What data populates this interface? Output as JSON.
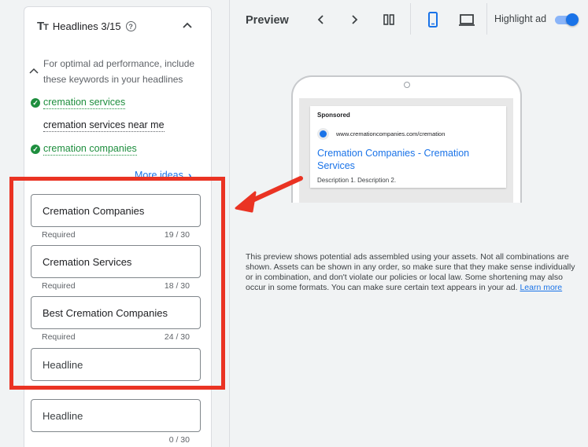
{
  "headlines_panel": {
    "title": "Headlines 3/15",
    "hint": "For optimal ad performance, include these keywords in your headlines",
    "keywords": [
      {
        "text": "cremation services",
        "used": true
      },
      {
        "text": "cremation services near me",
        "used": false
      },
      {
        "text": "cremation companies",
        "used": true
      }
    ],
    "more_ideas": "More ideas",
    "fields": [
      {
        "value": "Cremation Companies",
        "status": "Required",
        "count": "19 / 30"
      },
      {
        "value": "Cremation Services",
        "status": "Required",
        "count": "18 / 30"
      },
      {
        "value": "Best Cremation Companies",
        "status": "Required",
        "count": "24 / 30"
      },
      {
        "placeholder": "Headline"
      },
      {
        "placeholder": "Headline",
        "count": "0 / 30"
      }
    ]
  },
  "preview": {
    "title": "Preview",
    "highlight_ad_label": "Highlight ad",
    "highlight_ad_on": true,
    "ad": {
      "sponsored": "Sponsored",
      "url": "www.cremationcompanies.com/cremation",
      "headline": "Cremation Companies - Cremation Services",
      "description": "Description 1. Description 2."
    },
    "disclaimer": "This preview shows potential ads assembled using your assets. Not all combinations are shown. Assets can be shown in any order, so make sure that they make sense individually or in combination, and don't violate our policies or local law. Some shortening may also occur in some formats. You can make sure certain text appears in your ad.",
    "learn_more": "Learn more"
  },
  "colors": {
    "annotation_red": "#ea3323",
    "link_blue": "#1a73e8",
    "check_green": "#1e8e3e"
  },
  "icons": [
    "text-tt-icon",
    "help-icon",
    "chevron-up-icon",
    "check-circle-icon",
    "chevron-right-icon",
    "chevron-left-icon",
    "columns-icon",
    "mobile-icon",
    "desktop-icon",
    "globe-icon",
    "arrow-annotation"
  ]
}
